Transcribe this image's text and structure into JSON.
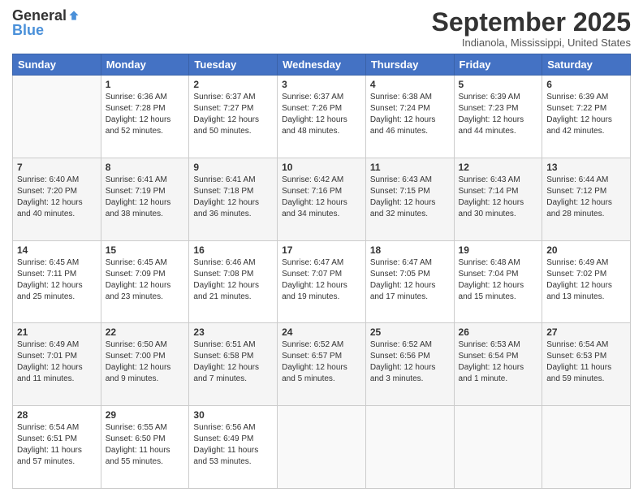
{
  "header": {
    "logo_general": "General",
    "logo_blue": "Blue",
    "month_title": "September 2025",
    "location": "Indianola, Mississippi, United States"
  },
  "days_of_week": [
    "Sunday",
    "Monday",
    "Tuesday",
    "Wednesday",
    "Thursday",
    "Friday",
    "Saturday"
  ],
  "weeks": [
    [
      {
        "day": "",
        "info": ""
      },
      {
        "day": "1",
        "info": "Sunrise: 6:36 AM\nSunset: 7:28 PM\nDaylight: 12 hours\nand 52 minutes."
      },
      {
        "day": "2",
        "info": "Sunrise: 6:37 AM\nSunset: 7:27 PM\nDaylight: 12 hours\nand 50 minutes."
      },
      {
        "day": "3",
        "info": "Sunrise: 6:37 AM\nSunset: 7:26 PM\nDaylight: 12 hours\nand 48 minutes."
      },
      {
        "day": "4",
        "info": "Sunrise: 6:38 AM\nSunset: 7:24 PM\nDaylight: 12 hours\nand 46 minutes."
      },
      {
        "day": "5",
        "info": "Sunrise: 6:39 AM\nSunset: 7:23 PM\nDaylight: 12 hours\nand 44 minutes."
      },
      {
        "day": "6",
        "info": "Sunrise: 6:39 AM\nSunset: 7:22 PM\nDaylight: 12 hours\nand 42 minutes."
      }
    ],
    [
      {
        "day": "7",
        "info": "Sunrise: 6:40 AM\nSunset: 7:20 PM\nDaylight: 12 hours\nand 40 minutes."
      },
      {
        "day": "8",
        "info": "Sunrise: 6:41 AM\nSunset: 7:19 PM\nDaylight: 12 hours\nand 38 minutes."
      },
      {
        "day": "9",
        "info": "Sunrise: 6:41 AM\nSunset: 7:18 PM\nDaylight: 12 hours\nand 36 minutes."
      },
      {
        "day": "10",
        "info": "Sunrise: 6:42 AM\nSunset: 7:16 PM\nDaylight: 12 hours\nand 34 minutes."
      },
      {
        "day": "11",
        "info": "Sunrise: 6:43 AM\nSunset: 7:15 PM\nDaylight: 12 hours\nand 32 minutes."
      },
      {
        "day": "12",
        "info": "Sunrise: 6:43 AM\nSunset: 7:14 PM\nDaylight: 12 hours\nand 30 minutes."
      },
      {
        "day": "13",
        "info": "Sunrise: 6:44 AM\nSunset: 7:12 PM\nDaylight: 12 hours\nand 28 minutes."
      }
    ],
    [
      {
        "day": "14",
        "info": "Sunrise: 6:45 AM\nSunset: 7:11 PM\nDaylight: 12 hours\nand 25 minutes."
      },
      {
        "day": "15",
        "info": "Sunrise: 6:45 AM\nSunset: 7:09 PM\nDaylight: 12 hours\nand 23 minutes."
      },
      {
        "day": "16",
        "info": "Sunrise: 6:46 AM\nSunset: 7:08 PM\nDaylight: 12 hours\nand 21 minutes."
      },
      {
        "day": "17",
        "info": "Sunrise: 6:47 AM\nSunset: 7:07 PM\nDaylight: 12 hours\nand 19 minutes."
      },
      {
        "day": "18",
        "info": "Sunrise: 6:47 AM\nSunset: 7:05 PM\nDaylight: 12 hours\nand 17 minutes."
      },
      {
        "day": "19",
        "info": "Sunrise: 6:48 AM\nSunset: 7:04 PM\nDaylight: 12 hours\nand 15 minutes."
      },
      {
        "day": "20",
        "info": "Sunrise: 6:49 AM\nSunset: 7:02 PM\nDaylight: 12 hours\nand 13 minutes."
      }
    ],
    [
      {
        "day": "21",
        "info": "Sunrise: 6:49 AM\nSunset: 7:01 PM\nDaylight: 12 hours\nand 11 minutes."
      },
      {
        "day": "22",
        "info": "Sunrise: 6:50 AM\nSunset: 7:00 PM\nDaylight: 12 hours\nand 9 minutes."
      },
      {
        "day": "23",
        "info": "Sunrise: 6:51 AM\nSunset: 6:58 PM\nDaylight: 12 hours\nand 7 minutes."
      },
      {
        "day": "24",
        "info": "Sunrise: 6:52 AM\nSunset: 6:57 PM\nDaylight: 12 hours\nand 5 minutes."
      },
      {
        "day": "25",
        "info": "Sunrise: 6:52 AM\nSunset: 6:56 PM\nDaylight: 12 hours\nand 3 minutes."
      },
      {
        "day": "26",
        "info": "Sunrise: 6:53 AM\nSunset: 6:54 PM\nDaylight: 12 hours\nand 1 minute."
      },
      {
        "day": "27",
        "info": "Sunrise: 6:54 AM\nSunset: 6:53 PM\nDaylight: 11 hours\nand 59 minutes."
      }
    ],
    [
      {
        "day": "28",
        "info": "Sunrise: 6:54 AM\nSunset: 6:51 PM\nDaylight: 11 hours\nand 57 minutes."
      },
      {
        "day": "29",
        "info": "Sunrise: 6:55 AM\nSunset: 6:50 PM\nDaylight: 11 hours\nand 55 minutes."
      },
      {
        "day": "30",
        "info": "Sunrise: 6:56 AM\nSunset: 6:49 PM\nDaylight: 11 hours\nand 53 minutes."
      },
      {
        "day": "",
        "info": ""
      },
      {
        "day": "",
        "info": ""
      },
      {
        "day": "",
        "info": ""
      },
      {
        "day": "",
        "info": ""
      }
    ]
  ]
}
